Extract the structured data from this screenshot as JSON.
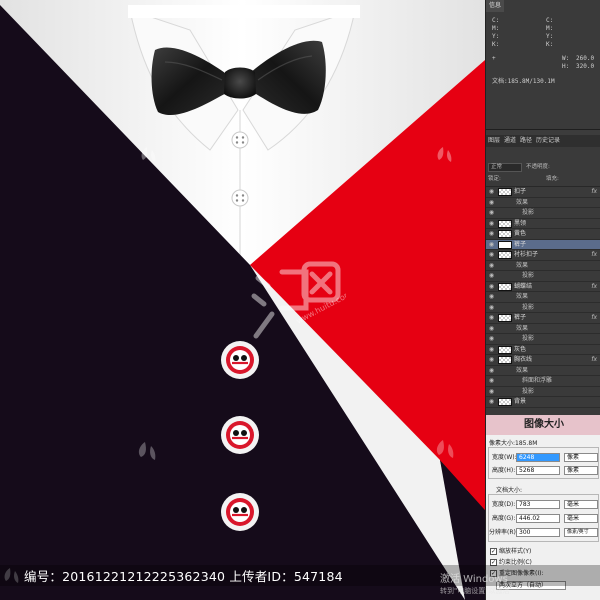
{
  "colors": {
    "jacket": "#150b1a",
    "lining": "#e60012",
    "shirt": "#f4f4f4",
    "bowtie": "#1e1e1e",
    "button_ring": "#d9172b",
    "ps_panel": "#3a3a3a",
    "dialog_title": "#e7c3cb"
  },
  "footer": {
    "text": "编号：20161221212225362340 上传者ID：547184"
  },
  "watermark": {
    "icon": "drop-logo-icon",
    "site_icon": "huitu-logo-icon"
  },
  "info_panel": {
    "tab": "信息",
    "readouts": [
      {
        "label": "C:",
        "value": ""
      },
      {
        "label": "M:",
        "value": ""
      },
      {
        "label": "Y:",
        "value": ""
      },
      {
        "label": "K:",
        "value": ""
      },
      {
        "label": "W:",
        "value": "260.0"
      },
      {
        "label": "H:",
        "value": "320.0"
      }
    ],
    "doc": "文档:185.8M/130.1M"
  },
  "layers_panel": {
    "tabs": [
      "图层",
      "通道",
      "路径",
      "历史记录"
    ],
    "blend_mode": "正常",
    "opacity_label": "不透明度:",
    "lock_label": "锁定:",
    "fill_label": "填充:",
    "layers": [
      {
        "name": "扣子",
        "type": "layer",
        "fx": "fx"
      },
      {
        "name": "效果",
        "type": "sub"
      },
      {
        "name": "投影",
        "type": "sub2"
      },
      {
        "name": "黑领",
        "type": "layer"
      },
      {
        "name": "黄色",
        "type": "layer"
      },
      {
        "name": "裤子",
        "type": "group"
      },
      {
        "name": "衬衫扣子",
        "type": "layer",
        "fx": "fx"
      },
      {
        "name": "效果",
        "type": "sub"
      },
      {
        "name": "投影",
        "type": "sub2"
      },
      {
        "name": "蝴蝶结",
        "type": "layer",
        "fx": "fx"
      },
      {
        "name": "效果",
        "type": "sub"
      },
      {
        "name": "投影",
        "type": "sub2"
      },
      {
        "name": "裤子",
        "type": "layer",
        "fx": "fx"
      },
      {
        "name": "效果",
        "type": "sub"
      },
      {
        "name": "投影",
        "type": "sub2"
      },
      {
        "name": "灰色",
        "type": "layer"
      },
      {
        "name": "胸衣线",
        "type": "layer",
        "fx": "fx"
      },
      {
        "name": "效果",
        "type": "sub"
      },
      {
        "name": "斜面和浮雕",
        "type": "sub2"
      },
      {
        "name": "投影",
        "type": "sub2"
      },
      {
        "name": "背景",
        "type": "layer"
      }
    ]
  },
  "image_size_dialog": {
    "title": "图像大小",
    "pixel_size": "像素大小:185.8M",
    "width_label": "宽度(W):",
    "width_value": "6248",
    "height_label": "高度(H):",
    "height_value": "5268",
    "pixel_unit": "像素",
    "doc_size": "文档大小:",
    "doc_width_label": "宽度(D):",
    "doc_width_value": "783",
    "doc_height_label": "高度(G):",
    "doc_height_value": "446.02",
    "resolution_label": "分辨率(R):",
    "resolution_value": "300",
    "mm_unit": "毫米",
    "res_unit": "像素/英寸",
    "checks": [
      "缩放样式(Y)",
      "约束比例(C)",
      "重定图像像素(I):"
    ],
    "resample": "两次立方（自动）"
  },
  "windows_activation": {
    "line1": "激活 Windows",
    "line2": "转到\"电脑设置\"以激活"
  }
}
